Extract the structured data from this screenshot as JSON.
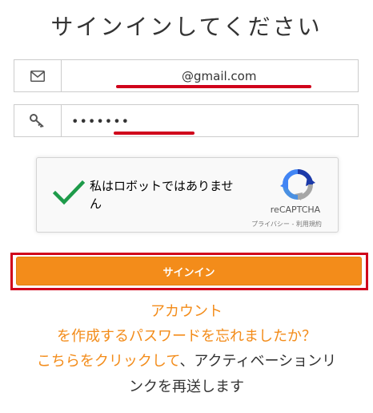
{
  "title": "サインインしてください",
  "email": {
    "icon": "envelope-icon",
    "value": "@gmail.com"
  },
  "password": {
    "icon": "key-icon",
    "value": "•••••••"
  },
  "captcha": {
    "label": "私はロボットではありません",
    "brand": "reCAPTCHA",
    "links": "プライバシー - 利用規約",
    "checked": true
  },
  "signin_button": "サインイン",
  "links": {
    "account_create": "アカウント",
    "forgot_password": "を作成するパスワードを忘れましたか？",
    "click_here": "こちらをクリックして",
    "resend_prefix": "、アクティベーションリ",
    "resend_suffix": "ンクを再送します"
  },
  "colors": {
    "accent": "#f38c1a",
    "highlight": "#d0021b",
    "check": "#1e9b4a"
  }
}
